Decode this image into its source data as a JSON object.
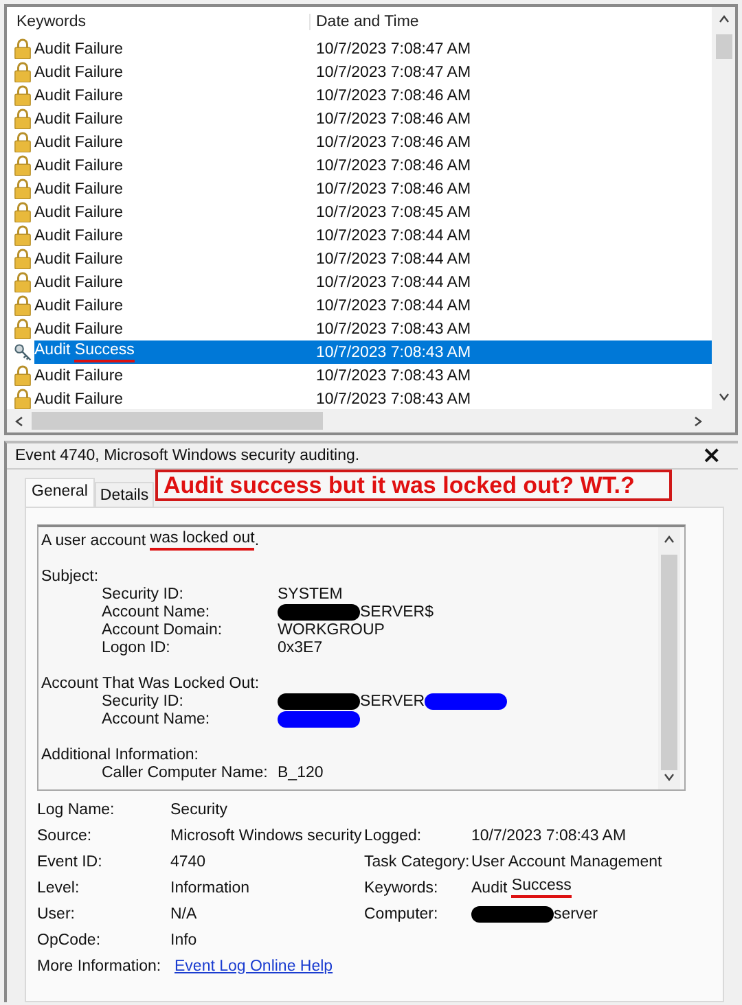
{
  "event_list": {
    "columns": [
      "Keywords",
      "Date and Time"
    ],
    "rows": [
      {
        "kind": "failure",
        "selected": false,
        "keyword": [
          {
            "text": "Audit Failure",
            "underlined": false
          }
        ],
        "time": "10/7/2023 7:08:47 AM"
      },
      {
        "kind": "failure",
        "selected": false,
        "keyword": [
          {
            "text": "Audit Failure",
            "underlined": false
          }
        ],
        "time": "10/7/2023 7:08:47 AM"
      },
      {
        "kind": "failure",
        "selected": false,
        "keyword": [
          {
            "text": "Audit Failure",
            "underlined": false
          }
        ],
        "time": "10/7/2023 7:08:46 AM"
      },
      {
        "kind": "failure",
        "selected": false,
        "keyword": [
          {
            "text": "Audit Failure",
            "underlined": false
          }
        ],
        "time": "10/7/2023 7:08:46 AM"
      },
      {
        "kind": "failure",
        "selected": false,
        "keyword": [
          {
            "text": "Audit Failure",
            "underlined": false
          }
        ],
        "time": "10/7/2023 7:08:46 AM"
      },
      {
        "kind": "failure",
        "selected": false,
        "keyword": [
          {
            "text": "Audit Failure",
            "underlined": false
          }
        ],
        "time": "10/7/2023 7:08:46 AM"
      },
      {
        "kind": "failure",
        "selected": false,
        "keyword": [
          {
            "text": "Audit Failure",
            "underlined": false
          }
        ],
        "time": "10/7/2023 7:08:46 AM"
      },
      {
        "kind": "failure",
        "selected": false,
        "keyword": [
          {
            "text": "Audit Failure",
            "underlined": false
          }
        ],
        "time": "10/7/2023 7:08:45 AM"
      },
      {
        "kind": "failure",
        "selected": false,
        "keyword": [
          {
            "text": "Audit Failure",
            "underlined": false
          }
        ],
        "time": "10/7/2023 7:08:44 AM"
      },
      {
        "kind": "failure",
        "selected": false,
        "keyword": [
          {
            "text": "Audit Failure",
            "underlined": false
          }
        ],
        "time": "10/7/2023 7:08:44 AM"
      },
      {
        "kind": "failure",
        "selected": false,
        "keyword": [
          {
            "text": "Audit Failure",
            "underlined": false
          }
        ],
        "time": "10/7/2023 7:08:44 AM"
      },
      {
        "kind": "failure",
        "selected": false,
        "keyword": [
          {
            "text": "Audit Failure",
            "underlined": false
          }
        ],
        "time": "10/7/2023 7:08:44 AM"
      },
      {
        "kind": "failure",
        "selected": false,
        "keyword": [
          {
            "text": "Audit Failure",
            "underlined": false
          }
        ],
        "time": "10/7/2023 7:08:43 AM"
      },
      {
        "kind": "success",
        "selected": true,
        "keyword": [
          {
            "text": "Audit ",
            "underlined": false
          },
          {
            "text": "Success",
            "underlined": true
          }
        ],
        "time": "10/7/2023 7:08:43 AM"
      },
      {
        "kind": "failure",
        "selected": false,
        "keyword": [
          {
            "text": "Audit Failure",
            "underlined": false
          }
        ],
        "time": "10/7/2023 7:08:43 AM"
      },
      {
        "kind": "failure",
        "selected": false,
        "keyword": [
          {
            "text": "Audit Failure",
            "underlined": false
          }
        ],
        "time": "10/7/2023 7:08:43 AM"
      }
    ]
  },
  "event_panel": {
    "title": "Event 4740, Microsoft Windows security auditing.",
    "close": "×",
    "tabs": [
      {
        "label": "General",
        "selected": true
      },
      {
        "label": "Details",
        "selected": false
      }
    ],
    "annotation": "Audit success but it was locked out? WT.?",
    "description": [
      {
        "text": "A user account ",
        "underlined": false
      },
      {
        "text": "was locked out",
        "underlined": true
      },
      {
        "text": ".",
        "underlined": false
      }
    ],
    "message": [
      {
        "kind": "heading",
        "label": "Subject:"
      },
      {
        "kind": "field",
        "label": "Security ID:",
        "value": [
          {
            "kind": "text",
            "text": "SYSTEM"
          }
        ]
      },
      {
        "kind": "field",
        "label": "Account Name:",
        "value": [
          {
            "kind": "redaction",
            "color": "#000000"
          },
          {
            "kind": "text",
            "text": "SERVER$"
          }
        ]
      },
      {
        "kind": "field",
        "label": "Account Domain:",
        "value": [
          {
            "kind": "text",
            "text": "WORKGROUP"
          }
        ]
      },
      {
        "kind": "field",
        "label": "Logon ID:",
        "value": [
          {
            "kind": "text",
            "text": "0x3E7"
          }
        ]
      },
      {
        "kind": "blank"
      },
      {
        "kind": "heading",
        "label": "Account That Was Locked Out:"
      },
      {
        "kind": "field",
        "label": "Security ID:",
        "value": [
          {
            "kind": "redaction",
            "color": "#000000"
          },
          {
            "kind": "text",
            "text": "SERVER"
          },
          {
            "kind": "redaction",
            "color": "#0000ff"
          }
        ]
      },
      {
        "kind": "field",
        "label": "Account Name:",
        "value": [
          {
            "kind": "redaction",
            "color": "#0000ff"
          }
        ]
      },
      {
        "kind": "blank"
      },
      {
        "kind": "heading",
        "label": "Additional Information:"
      },
      {
        "kind": "field",
        "label": "Caller Computer Name:",
        "value": [
          {
            "kind": "text",
            "text": "B_120"
          }
        ]
      }
    ],
    "properties": [
      {
        "label": "Log Name:",
        "value": [
          {
            "kind": "text",
            "text": "Security"
          }
        ]
      },
      {
        "label": "Source:",
        "value": [
          {
            "kind": "text",
            "text": "Microsoft Windows security"
          }
        ],
        "label2": "Logged:",
        "value2": [
          {
            "kind": "text",
            "text": "10/7/2023 7:08:43 AM"
          }
        ]
      },
      {
        "label": "Event ID:",
        "value": [
          {
            "kind": "text",
            "text": "4740"
          }
        ],
        "label2": "Task Category:",
        "value2": [
          {
            "kind": "text",
            "text": "User Account Management"
          }
        ]
      },
      {
        "label": "Level:",
        "value": [
          {
            "kind": "text",
            "text": "Information"
          }
        ],
        "label2": "Keywords:",
        "value2": [
          {
            "kind": "text",
            "text": "Audit "
          },
          {
            "kind": "underlined",
            "text": "Success"
          }
        ]
      },
      {
        "label": "User:",
        "value": [
          {
            "kind": "text",
            "text": "N/A"
          }
        ],
        "label2": "Computer:",
        "value2": [
          {
            "kind": "redaction",
            "color": "#000000"
          },
          {
            "kind": "text",
            "text": "server"
          }
        ]
      },
      {
        "label": "OpCode:",
        "value": [
          {
            "kind": "text",
            "text": "Info"
          }
        ]
      },
      {
        "label": "More Information:",
        "value": [
          {
            "kind": "link",
            "text": "Event Log Online Help"
          }
        ]
      }
    ]
  }
}
